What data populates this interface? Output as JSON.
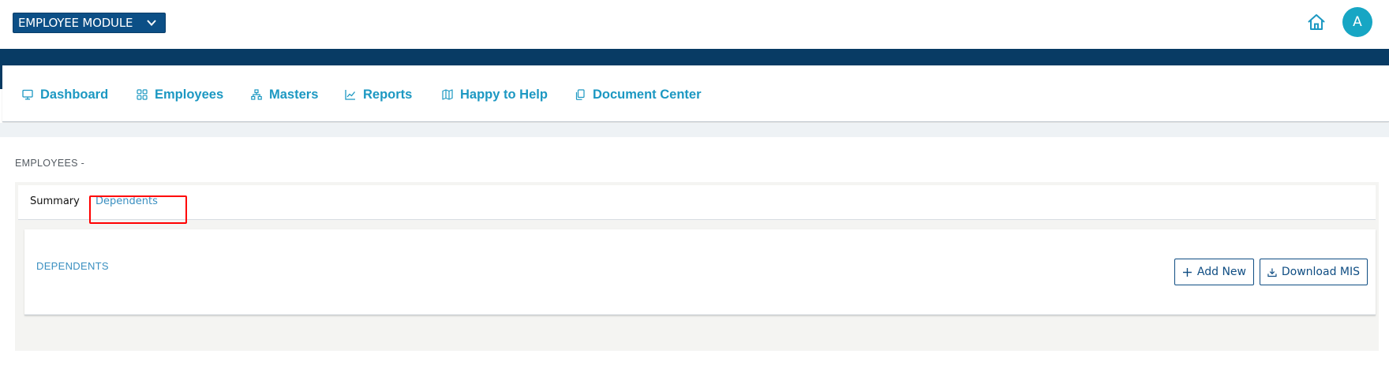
{
  "header": {
    "module_label": "EMPLOYEE MODULE",
    "avatar_initial": "A"
  },
  "nav": {
    "items": [
      {
        "label": "Dashboard",
        "icon": "monitor-icon"
      },
      {
        "label": "Employees",
        "icon": "grid-icon"
      },
      {
        "label": "Masters",
        "icon": "hierarchy-icon"
      },
      {
        "label": "Reports",
        "icon": "chart-line-icon"
      },
      {
        "label": "Happy to Help",
        "icon": "map-icon"
      },
      {
        "label": "Document Center",
        "icon": "documents-icon"
      }
    ]
  },
  "page": {
    "heading": "EMPLOYEES -",
    "tabs": [
      {
        "label": "Summary"
      },
      {
        "label": "Dependents",
        "active": true
      }
    ],
    "card": {
      "title": "DEPENDENTS",
      "add_label": "Add New",
      "download_label": "Download MIS"
    }
  },
  "colors": {
    "brand_navy": "#0c4f86",
    "nav_link": "#1c98c2",
    "avatar": "#17a6c4",
    "highlight": "#ff0000"
  }
}
